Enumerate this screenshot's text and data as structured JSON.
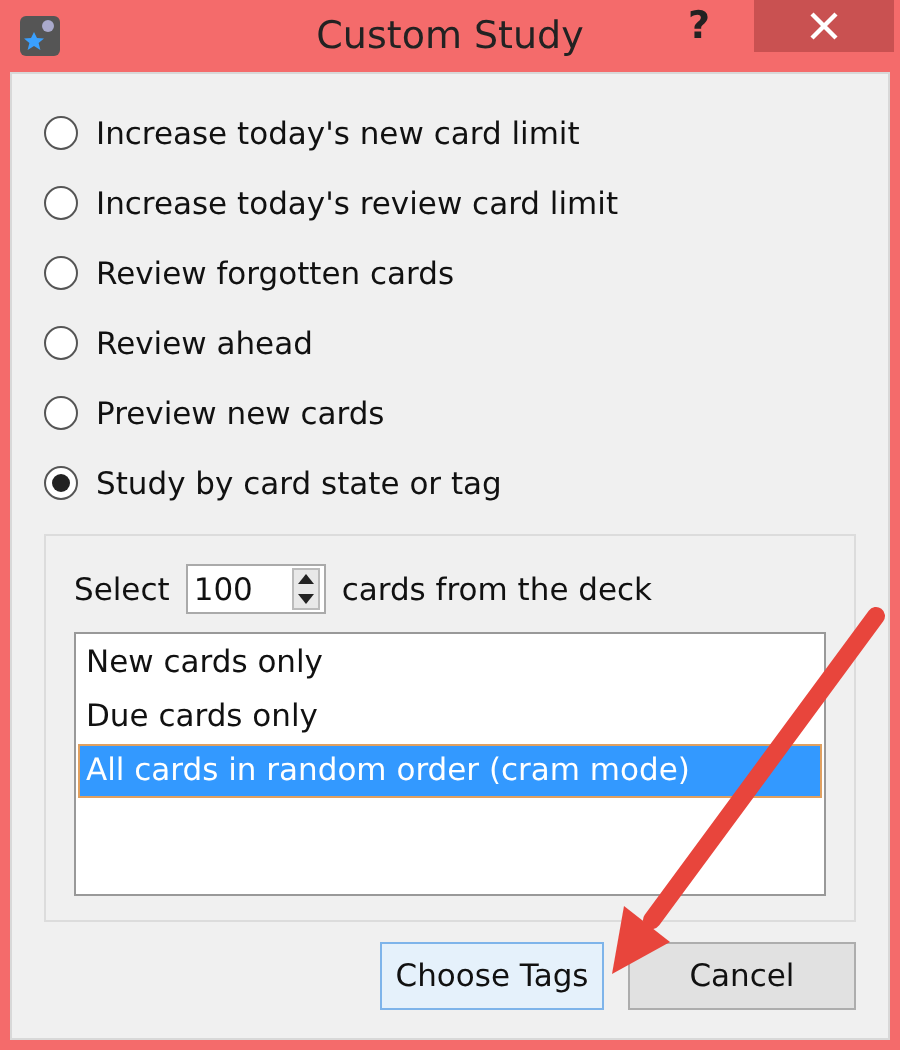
{
  "window": {
    "title": "Custom Study",
    "help": "?"
  },
  "options": [
    {
      "label": "Increase today's new card limit",
      "selected": false
    },
    {
      "label": "Increase today's review card limit",
      "selected": false
    },
    {
      "label": "Review forgotten cards",
      "selected": false
    },
    {
      "label": "Review ahead",
      "selected": false
    },
    {
      "label": "Preview new cards",
      "selected": false
    },
    {
      "label": "Study by card state or tag",
      "selected": true
    }
  ],
  "select_row": {
    "prefix": "Select",
    "value": "100",
    "suffix": "cards from the deck"
  },
  "card_types": [
    {
      "label": "New cards only",
      "selected": false
    },
    {
      "label": "Due cards only",
      "selected": false
    },
    {
      "label": "All cards in random order (cram mode)",
      "selected": true
    }
  ],
  "buttons": [
    {
      "label": "Choose Tags",
      "default": true
    },
    {
      "label": "Cancel",
      "default": false
    }
  ]
}
